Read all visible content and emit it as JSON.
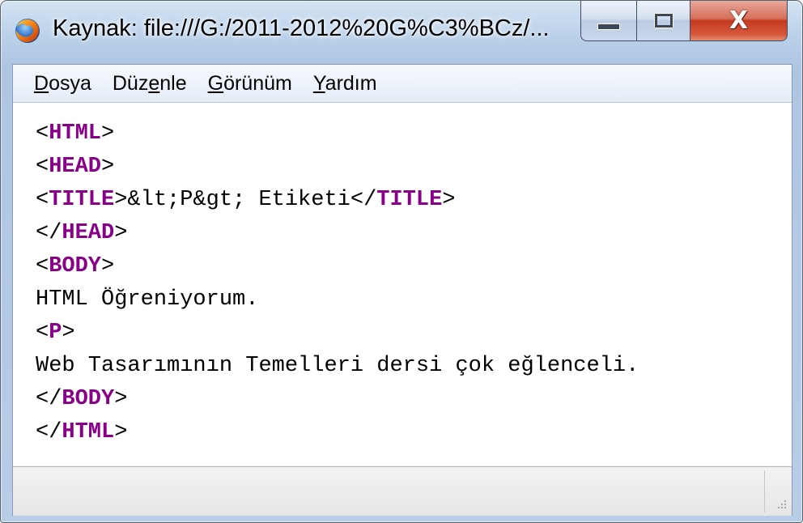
{
  "window": {
    "title": "Kaynak: file:///G:/2011-2012%20G%C3%BCz/...",
    "app_icon": "firefox-icon",
    "controls": {
      "minimize_icon": "minimize-icon",
      "maximize_icon": "maximize-icon",
      "close_glyph": "X"
    }
  },
  "menu": {
    "items": [
      {
        "pre": "",
        "key": "D",
        "post": "osya"
      },
      {
        "pre": "Düz",
        "key": "e",
        "post": "nle"
      },
      {
        "pre": "",
        "key": "G",
        "post": "örünüm"
      },
      {
        "pre": "",
        "key": "Y",
        "post": "ardım"
      }
    ]
  },
  "source_lines": [
    [
      {
        "t": "<",
        "c": "p"
      },
      {
        "t": "HTML",
        "c": "tag"
      },
      {
        "t": ">",
        "c": "p"
      }
    ],
    [
      {
        "t": "<",
        "c": "p"
      },
      {
        "t": "HEAD",
        "c": "tag"
      },
      {
        "t": ">",
        "c": "p"
      }
    ],
    [
      {
        "t": "<",
        "c": "p"
      },
      {
        "t": "TITLE",
        "c": "tag"
      },
      {
        "t": ">&lt;P&gt; Etiketi</",
        "c": "p"
      },
      {
        "t": "TITLE",
        "c": "tag"
      },
      {
        "t": ">",
        "c": "p"
      }
    ],
    [
      {
        "t": "</",
        "c": "p"
      },
      {
        "t": "HEAD",
        "c": "tag"
      },
      {
        "t": ">",
        "c": "p"
      }
    ],
    [
      {
        "t": "<",
        "c": "p"
      },
      {
        "t": "BODY",
        "c": "tag"
      },
      {
        "t": ">",
        "c": "p"
      }
    ],
    [
      {
        "t": "HTML Öğreniyorum.",
        "c": "p"
      }
    ],
    [
      {
        "t": "<",
        "c": "p"
      },
      {
        "t": "P",
        "c": "tag"
      },
      {
        "t": ">",
        "c": "p"
      }
    ],
    [
      {
        "t": "Web Tasarımının Temelleri dersi çok eğlenceli.",
        "c": "p"
      }
    ],
    [
      {
        "t": "</",
        "c": "p"
      },
      {
        "t": "BODY",
        "c": "tag"
      },
      {
        "t": ">",
        "c": "p"
      }
    ],
    [
      {
        "t": "</",
        "c": "p"
      },
      {
        "t": "HTML",
        "c": "tag"
      },
      {
        "t": ">",
        "c": "p"
      }
    ]
  ],
  "colors": {
    "tag": "#880088",
    "text": "#000000"
  },
  "statusbar": {
    "text": "",
    "resize_grip_icon": "resize-grip-icon"
  }
}
